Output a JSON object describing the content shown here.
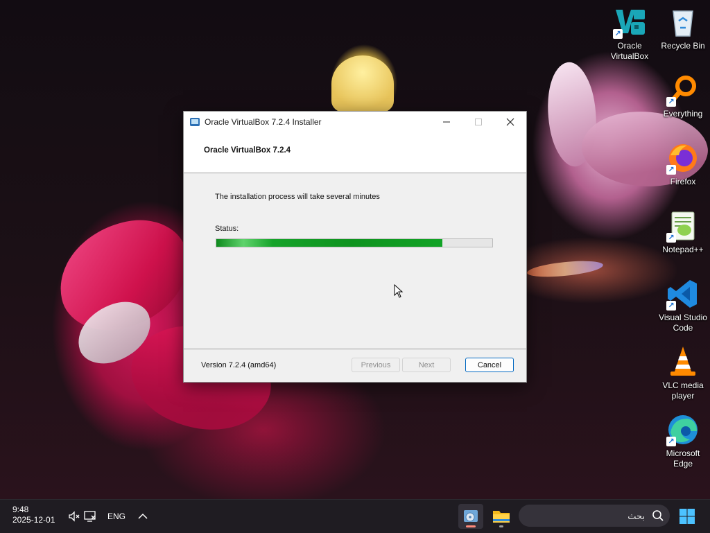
{
  "desktop": {
    "icons": [
      {
        "label_line1": "Oracle",
        "label_line2": "VirtualBox"
      },
      {
        "label_line1": "Recycle Bin",
        "label_line2": ""
      },
      {
        "label_line1": "Everything",
        "label_line2": ""
      },
      {
        "label_line1": "Firefox",
        "label_line2": ""
      },
      {
        "label_line1": "Notepad++",
        "label_line2": ""
      },
      {
        "label_line1": "Visual Studio",
        "label_line2": "Code"
      },
      {
        "label_line1": "VLC media",
        "label_line2": "player"
      },
      {
        "label_line1": "Microsoft",
        "label_line2": "Edge"
      }
    ]
  },
  "installer": {
    "title": "Oracle VirtualBox 7.2.4 Installer",
    "heading": "Oracle VirtualBox 7.2.4",
    "message": "The installation process will take several minutes",
    "status_label": "Status:",
    "progress_percent": 82,
    "version": "Version 7.2.4 (amd64)",
    "buttons": {
      "previous": "Previous",
      "next": "Next",
      "cancel": "Cancel"
    },
    "accent_color": "#0f931f"
  },
  "taskbar": {
    "time": "9:48",
    "date": "2025-12-01",
    "language": "ENG",
    "search_placeholder": "بحث"
  }
}
